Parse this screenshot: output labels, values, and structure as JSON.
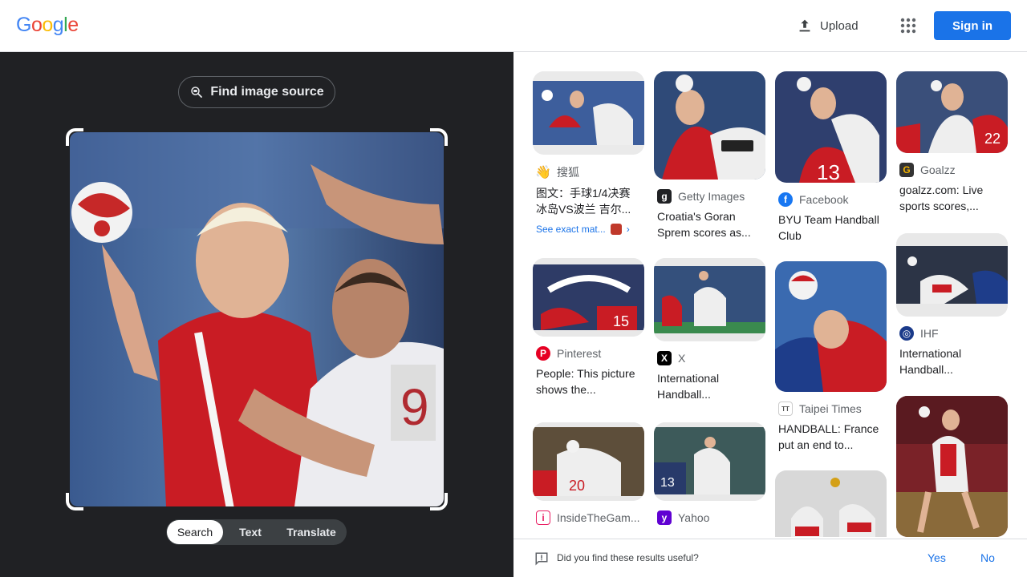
{
  "header": {
    "logo_letters": [
      "G",
      "o",
      "o",
      "g",
      "l",
      "e"
    ],
    "logo_colors": [
      "#4285F4",
      "#EA4335",
      "#FBBC05",
      "#4285F4",
      "#34A853",
      "#EA4335"
    ],
    "upload_label": "Upload",
    "signin_label": "Sign in"
  },
  "left": {
    "find_source_label": "Find image source",
    "tabs": [
      "Search",
      "Text",
      "Translate"
    ],
    "active_tab": "Search"
  },
  "results": [
    {
      "source": "搜狐",
      "icon": "sohu-icon",
      "title": "图文：手球1/4决赛冰岛VS波兰 吉尔...",
      "exact_match": "See exact mat..."
    },
    {
      "source": "Getty Images",
      "icon": "getty-icon",
      "title": "Croatia's Goran Sprem scores as..."
    },
    {
      "source": "Facebook",
      "icon": "facebook-icon",
      "title": "BYU Team Handball Club"
    },
    {
      "source": "Goalzz",
      "icon": "goalzz-icon",
      "title": "goalzz.com: Live sports scores,..."
    },
    {
      "source": "Pinterest",
      "icon": "pinterest-icon",
      "title": "People: This picture shows the..."
    },
    {
      "source": "X",
      "icon": "x-icon",
      "title": "International Handball..."
    },
    {
      "source": "Taipei Times",
      "icon": "taipei-times-icon",
      "title": "HANDBALL: France put an end to..."
    },
    {
      "source": "IHF",
      "icon": "ihf-icon",
      "title": "International Handball..."
    },
    {
      "source": "InsideTheGam...",
      "icon": "insidethegames-icon",
      "title": ""
    },
    {
      "source": "Yahoo",
      "icon": "yahoo-icon",
      "title": ""
    }
  ],
  "feedback": {
    "question": "Did you find these results useful?",
    "yes": "Yes",
    "no": "No"
  }
}
